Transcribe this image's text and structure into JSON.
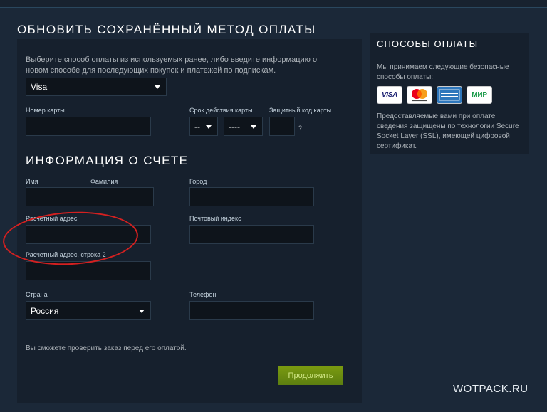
{
  "page": {
    "title": "ОБНОВИТЬ СОХРАНЁННЫЙ МЕТОД ОПЛАТЫ"
  },
  "payment": {
    "description": "Выберите способ оплаты из используемых ранее, либо введите информацию о новом способе для последующих покупок и платежей по подпискам.",
    "method_selected": "Visa",
    "card_number_label": "Номер карты",
    "expiry_label": "Срок действия карты",
    "expiry_month_value": "--",
    "expiry_year_value": "----",
    "cvv_label": "Защитный код карты",
    "cvv_help": "?"
  },
  "billing": {
    "section_title": "ИНФОРМАЦИЯ О СЧЕТЕ",
    "first_name_label": "Имя",
    "last_name_label": "Фамилия",
    "city_label": "Город",
    "address_label": "Расчетный адрес",
    "zip_label": "Почтовый индекс",
    "address2_label": "Расчетный адрес, строка 2",
    "country_label": "Страна",
    "country_value": "Россия",
    "phone_label": "Телефон"
  },
  "footer": {
    "note": "Вы сможете проверить заказ перед его оплатой.",
    "continue_label": "Продолжить"
  },
  "sidebar": {
    "title": "СПОСОБЫ ОПЛАТЫ",
    "text1": "Мы принимаем следующие безопасные способы оплаты:",
    "logos": [
      {
        "name": "visa-logo",
        "text": "VISA"
      },
      {
        "name": "mastercard-logo",
        "text": "mastercard"
      },
      {
        "name": "amex-logo",
        "text": "AMERICAN EXPRESS"
      },
      {
        "name": "mir-logo",
        "text": "МИР"
      }
    ],
    "text2": "Предоставляемые вами при оплате сведения защищены по технологии Secure Socket Layer (SSL), имеющей цифровой сертификат."
  },
  "watermark": "WOTPACK.RU",
  "colors": {
    "background": "#1b2838",
    "panel": "#16202d",
    "input": "#0e141b",
    "button": "#6a8c10",
    "highlight_circle": "#d42020"
  }
}
